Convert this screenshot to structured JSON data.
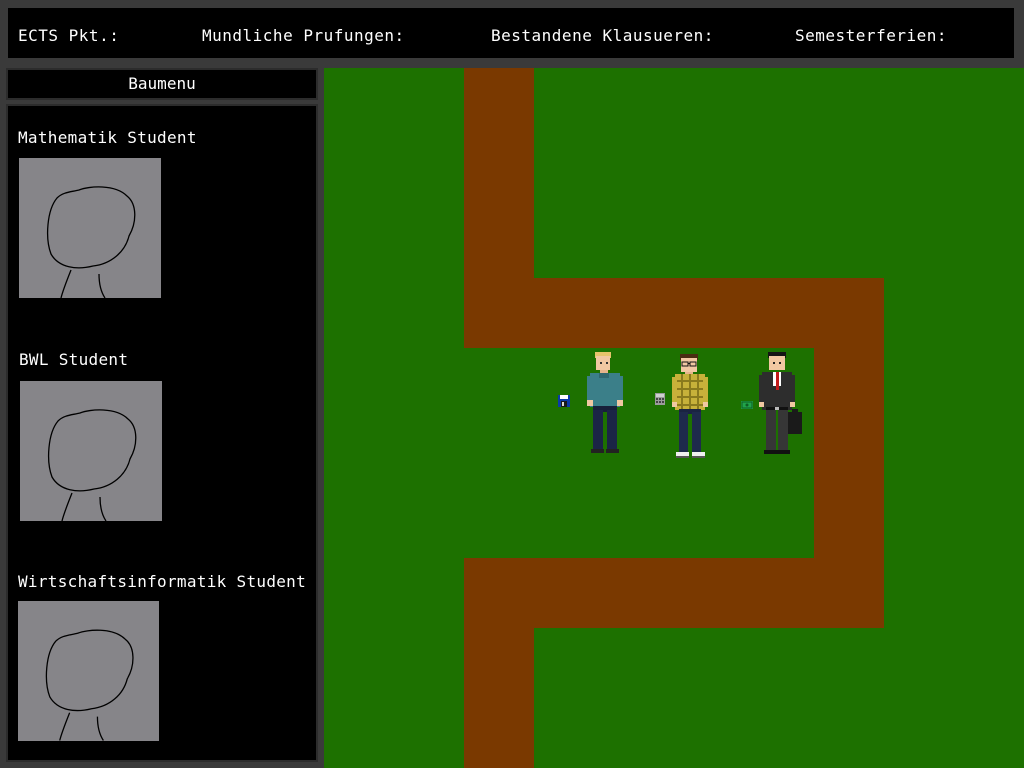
{
  "stats": {
    "ects_label": "ECTS Pkt.:",
    "oral_exams_label": "Mundliche Prufungen:",
    "passed_exams_label": "Bestandene Klausueren:",
    "semester_break_label": "Semesterferien:"
  },
  "build_menu": {
    "title": "Baumenu",
    "units": [
      {
        "name": "Mathematik Student",
        "portrait_icon": "student-portrait-sketch"
      },
      {
        "name": "BWL Student",
        "portrait_icon": "student-portrait-sketch"
      },
      {
        "name": "Wirtschaftsinformatik Student",
        "portrait_icon": "student-portrait-sketch"
      }
    ]
  },
  "map": {
    "colors": {
      "grass": "#1d7100",
      "path": "#7a3900",
      "panel": "#000000",
      "frame": "#3a3a3a",
      "portrait_bg": "#868589"
    },
    "characters": [
      {
        "type": "mathematik-student",
        "item_icon": "floppy-disk-icon"
      },
      {
        "type": "wirtschaftsinformatik-student",
        "item_icon": "calculator-icon"
      },
      {
        "type": "bwl-student",
        "item_icon": "money-icon"
      }
    ]
  }
}
